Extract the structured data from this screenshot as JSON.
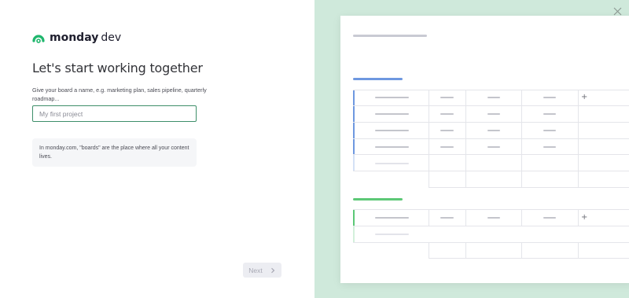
{
  "brand": {
    "name": "monday",
    "product": "dev"
  },
  "onboarding": {
    "title": "Let's start working together",
    "helper": "Give your board a name, e.g. marketing plan, sales pipeline, quarterly roadmap...",
    "input_value": "",
    "input_placeholder": "My first project",
    "info": "In monday.com, \"boards\" are the place where all your content lives.",
    "next_label": "Next"
  },
  "preview": {
    "add_column_symbol": "+"
  },
  "colors": {
    "brand_green": "#1fb66d",
    "logo_red": "#fb275d",
    "logo_yellow": "#ffcb00",
    "group1_accent": "#6e98e0",
    "group2_accent": "#5cc876",
    "panel_bg": "#cfe9db"
  },
  "icons": {
    "logo": "monday-logo-icon",
    "next": "chevron-right-icon",
    "close": "close-icon"
  }
}
